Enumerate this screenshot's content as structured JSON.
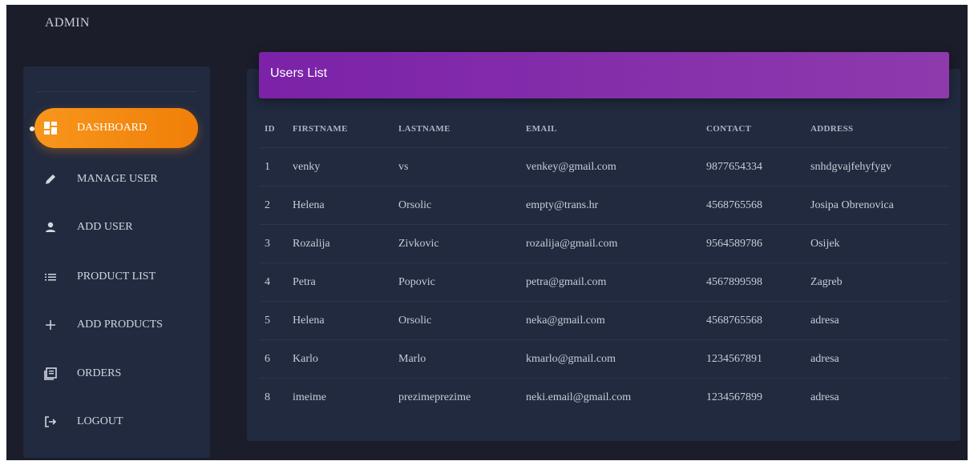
{
  "brand": {
    "title": "ADMIN"
  },
  "sidebar": {
    "items": [
      {
        "label": "DASHBOARD",
        "icon": "dashboard-icon",
        "active": true
      },
      {
        "label": "MANAGE USER",
        "icon": "pencil-icon",
        "active": false
      },
      {
        "label": "ADD USER",
        "icon": "person-icon",
        "active": false
      },
      {
        "label": "PRODUCT LIST",
        "icon": "list-icon",
        "active": false
      },
      {
        "label": "ADD PRODUCTS",
        "icon": "plus-icon",
        "active": false
      },
      {
        "label": "ORDERS",
        "icon": "orders-icon",
        "active": false
      },
      {
        "label": "LOGOUT",
        "icon": "logout-icon",
        "active": false
      }
    ]
  },
  "main": {
    "card_title": "Users List",
    "columns": [
      "ID",
      "FIRSTNAME",
      "LASTNAME",
      "EMAIL",
      "CONTACT",
      "ADDRESS"
    ],
    "rows": [
      [
        "1",
        "venky",
        "vs",
        "venkey@gmail.com",
        "9877654334",
        "snhdgvajfehyfygv"
      ],
      [
        "2",
        "Helena",
        "Orsolic",
        "empty@trans.hr",
        "4568765568",
        "Josipa Obrenovica"
      ],
      [
        "3",
        "Rozalija",
        "Zivkovic",
        "rozalija@gmail.com",
        "9564589786",
        "Osijek"
      ],
      [
        "4",
        "Petra",
        "Popovic",
        "petra@gmail.com",
        "4567899598",
        "Zagreb"
      ],
      [
        "5",
        "Helena",
        "Orsolic",
        "neka@gmail.com",
        "4568765568",
        "adresa"
      ],
      [
        "6",
        "Karlo",
        "Marlo",
        "kmarlo@gmail.com",
        "1234567891",
        "adresa"
      ],
      [
        "8",
        "imeime",
        "prezimeprezime",
        "neki.email@gmail.com",
        "1234567899",
        "adresa"
      ]
    ]
  },
  "colors": {
    "background": "#1b1d2b",
    "panel": "#212a3f",
    "accent": "#f08a10",
    "header_purple": "#7b22a8"
  }
}
